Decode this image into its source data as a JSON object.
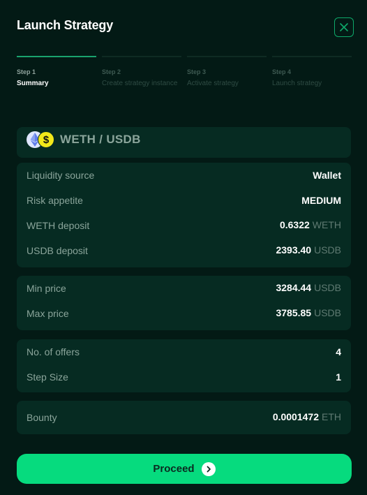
{
  "header": {
    "title": "Launch Strategy",
    "close_icon": "close-icon",
    "accent": "#0ea96a"
  },
  "steps": [
    {
      "num": "Step 1",
      "label": "Summary",
      "active": true
    },
    {
      "num": "Step 2",
      "label": "Create strategy instance",
      "active": false
    },
    {
      "num": "Step 3",
      "label": "Activate strategy",
      "active": false
    },
    {
      "num": "Step 4",
      "label": "Launch strategy",
      "active": false
    }
  ],
  "pair": {
    "name": "WETH / USDB",
    "icons": [
      "eth-icon",
      "usdb-icon"
    ],
    "usdb_glyph": "$"
  },
  "details": {
    "liquidity_source": {
      "label": "Liquidity source",
      "value": "Wallet"
    },
    "risk_appetite": {
      "label": "Risk appetite",
      "value": "MEDIUM"
    },
    "weth_deposit": {
      "label": "WETH deposit",
      "value": "0.6322",
      "unit": "WETH"
    },
    "usdb_deposit": {
      "label": "USDB deposit",
      "value": "2393.40",
      "unit": "USDB"
    },
    "min_price": {
      "label": "Min price",
      "value": "3284.44",
      "unit": "USDB"
    },
    "max_price": {
      "label": "Max price",
      "value": "3785.85",
      "unit": "USDB"
    },
    "offers": {
      "label": "No. of offers",
      "value": "4"
    },
    "step_size": {
      "label": "Step Size",
      "value": "1"
    },
    "bounty": {
      "label": "Bounty",
      "value": "0.0001472",
      "unit": "ETH"
    }
  },
  "footer": {
    "proceed_label": "Proceed",
    "proceed_icon": "chevron-right-icon",
    "button_color": "#06db7e"
  }
}
